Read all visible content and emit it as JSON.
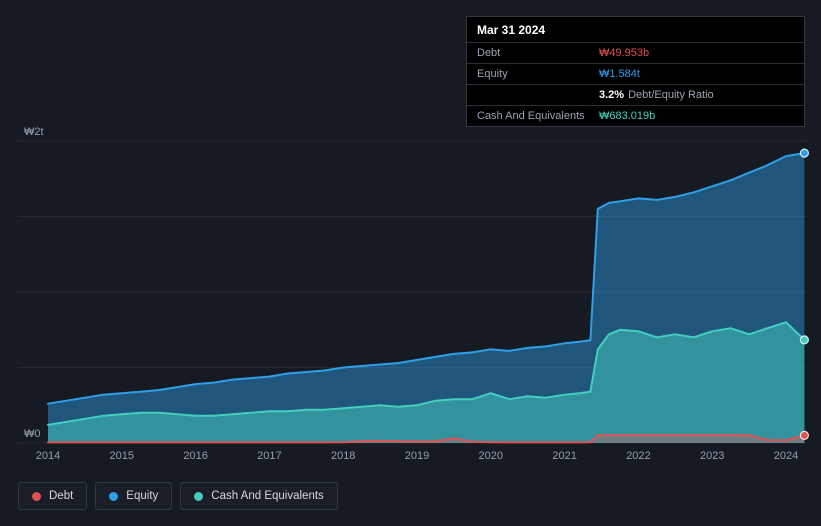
{
  "colors": {
    "background": "#151a23",
    "debt": "#e05252",
    "equity": "#2f9fe8",
    "cash": "#43cfc0",
    "grid": "rgba(255,255,255,0.07)",
    "axis_text": "#94a0ad",
    "tooltip_bg": "#000000",
    "tooltip_separator": "#2a2f37",
    "tooltip_label": "#9aa4b1"
  },
  "tooltip": {
    "date": "Mar 31 2024",
    "debt_label": "Debt",
    "debt_value": "₩49.953b",
    "equity_label": "Equity",
    "equity_value": "₩1.584t",
    "ratio_value": "3.2%",
    "ratio_text": "Debt/Equity Ratio",
    "cash_label": "Cash And Equivalents",
    "cash_value": "₩683.019b"
  },
  "legend": {
    "items": [
      {
        "label": "Debt",
        "key": "debt"
      },
      {
        "label": "Equity",
        "key": "equity"
      },
      {
        "label": "Cash And Equivalents",
        "key": "cash"
      }
    ]
  },
  "chart_data": {
    "type": "area",
    "title": "Debt to Equity history",
    "xlabel": "",
    "ylabel": "",
    "units": "trillions of KRW (₩)",
    "ylim": [
      0,
      2
    ],
    "xlim": [
      2013.6,
      2024.5
    ],
    "grid": "horizontal",
    "legend_position": "bottom-left",
    "stacked": false,
    "gridlines": [
      2,
      1.5,
      1,
      0.5,
      0
    ],
    "y_ticks": [
      {
        "label": "₩2t",
        "value": 2
      },
      {
        "label": "₩0",
        "value": 0
      }
    ],
    "x_ticks": [
      2014,
      2015,
      2016,
      2017,
      2018,
      2019,
      2020,
      2021,
      2022,
      2023,
      2024
    ],
    "x": [
      2014,
      2014.25,
      2014.5,
      2014.75,
      2015,
      2015.25,
      2015.5,
      2015.75,
      2016,
      2016.25,
      2016.5,
      2016.75,
      2017,
      2017.25,
      2017.5,
      2017.75,
      2018,
      2018.25,
      2018.5,
      2018.75,
      2019,
      2019.25,
      2019.5,
      2019.75,
      2020,
      2020.25,
      2020.5,
      2020.75,
      2021,
      2021.2,
      2021.35,
      2021.45,
      2021.6,
      2021.75,
      2022,
      2022.25,
      2022.5,
      2022.75,
      2023,
      2023.25,
      2023.5,
      2023.75,
      2024,
      2024.25
    ],
    "series": [
      {
        "name": "Equity",
        "color_key": "equity",
        "last_point_label": "₩1.584t (Mar 31 2024 tooltip)",
        "values": [
          0.26,
          0.28,
          0.3,
          0.32,
          0.33,
          0.34,
          0.35,
          0.37,
          0.39,
          0.4,
          0.42,
          0.43,
          0.44,
          0.46,
          0.47,
          0.48,
          0.5,
          0.51,
          0.52,
          0.53,
          0.55,
          0.57,
          0.59,
          0.6,
          0.62,
          0.61,
          0.63,
          0.64,
          0.66,
          0.67,
          0.68,
          1.55,
          1.59,
          1.6,
          1.62,
          1.61,
          1.63,
          1.66,
          1.7,
          1.74,
          1.79,
          1.84,
          1.9,
          1.92
        ]
      },
      {
        "name": "Cash And Equivalents",
        "color_key": "cash",
        "last_point_label": "₩683.019b (Mar 31 2024 tooltip)",
        "values": [
          0.12,
          0.14,
          0.16,
          0.18,
          0.19,
          0.2,
          0.2,
          0.19,
          0.18,
          0.18,
          0.19,
          0.2,
          0.21,
          0.21,
          0.22,
          0.22,
          0.23,
          0.24,
          0.25,
          0.24,
          0.25,
          0.28,
          0.29,
          0.29,
          0.33,
          0.29,
          0.31,
          0.3,
          0.32,
          0.33,
          0.34,
          0.62,
          0.72,
          0.75,
          0.74,
          0.7,
          0.72,
          0.7,
          0.74,
          0.76,
          0.72,
          0.76,
          0.8,
          0.683
        ]
      },
      {
        "name": "Debt",
        "color_key": "debt",
        "last_point_label": "₩49.953b (Mar 31 2024 tooltip)",
        "values": [
          0.004,
          0.004,
          0.004,
          0.004,
          0.004,
          0.004,
          0.004,
          0.004,
          0.004,
          0.004,
          0.004,
          0.004,
          0.004,
          0.004,
          0.004,
          0.004,
          0.005,
          0.012,
          0.014,
          0.012,
          0.01,
          0.012,
          0.03,
          0.008,
          0.005,
          0.004,
          0.004,
          0.004,
          0.004,
          0.004,
          0.005,
          0.05,
          0.052,
          0.052,
          0.052,
          0.052,
          0.052,
          0.052,
          0.052,
          0.052,
          0.05,
          0.02,
          0.018,
          0.05
        ]
      }
    ]
  }
}
